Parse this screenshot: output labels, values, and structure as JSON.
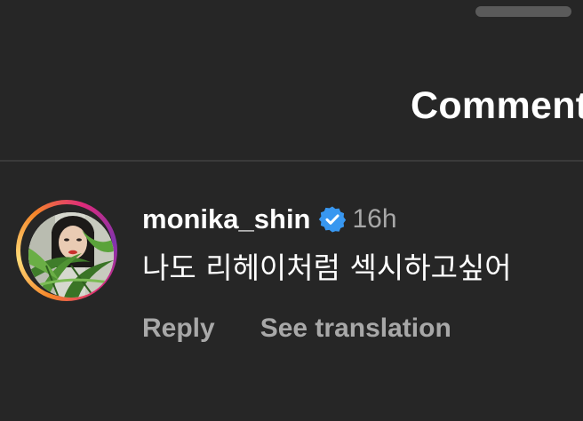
{
  "header": {
    "title": "Comments"
  },
  "comment": {
    "username": "monika_shin",
    "verified": true,
    "time": "16h",
    "text": "나도 리헤이처럼 섹시하고싶어",
    "actions": {
      "reply": "Reply",
      "see_translation": "See translation"
    }
  },
  "icons": {
    "verified": "verified-badge-icon"
  },
  "colors": {
    "background": "#262626",
    "primary_text": "#ffffff",
    "secondary_text": "#a8a8a8",
    "verified_badge": "#3897f0",
    "divider": "#3a3a3a",
    "story_ring": [
      "#f58529",
      "#feda77",
      "#dd2a7b",
      "#8134af"
    ]
  }
}
